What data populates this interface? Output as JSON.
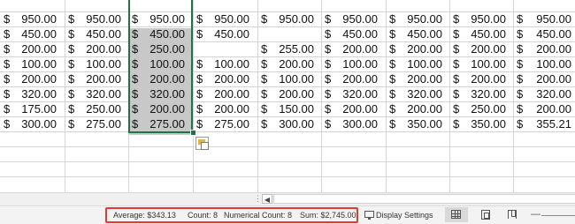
{
  "sheet": {
    "currency_symbol": "$",
    "columns": [
      [
        "950.00",
        "450.00",
        "200.00",
        "100.00",
        "200.00",
        "320.00",
        "175.00",
        "300.00"
      ],
      [
        "950.00",
        "450.00",
        "200.00",
        "100.00",
        "200.00",
        "320.00",
        "250.00",
        "275.00"
      ],
      [
        "950.00",
        "450.00",
        "250.00",
        "100.00",
        "200.00",
        "320.00",
        "200.00",
        "275.00"
      ],
      [
        "950.00",
        "450.00",
        "",
        "100.00",
        "200.00",
        "200.00",
        "200.00",
        "275.00"
      ],
      [
        "950.00",
        "",
        "255.00",
        "200.00",
        "100.00",
        "200.00",
        "150.00",
        "300.00"
      ],
      [
        "950.00",
        "450.00",
        "200.00",
        "100.00",
        "200.00",
        "320.00",
        "200.00",
        "300.00"
      ],
      [
        "950.00",
        "450.00",
        "200.00",
        "100.00",
        "200.00",
        "320.00",
        "200.00",
        "350.00"
      ],
      [
        "950.00",
        "450.00",
        "200.00",
        "100.00",
        "200.00",
        "320.00",
        "250.00",
        "350.00"
      ],
      [
        "950.00",
        "450.00",
        "200.00",
        "100.00",
        "200.00",
        "320.00",
        "200.00",
        "355.21"
      ]
    ],
    "selected_column": 2
  },
  "status_bar": {
    "average": "Average:  $343.13",
    "count": "Count: 8",
    "numerical_count": "Numerical Count: 8",
    "sum": "Sum:  $2,745.00",
    "display_settings": "Display Settings",
    "zoom_minus": "—"
  },
  "colors": {
    "selection_border": "#217346",
    "selection_fill": "#c8c8c8",
    "highlight_box": "#e4392f",
    "gridline": "#d4d4d4"
  },
  "icons": [
    "quick-analysis-icon",
    "display-settings-icon",
    "normal-view-icon",
    "page-layout-view-icon",
    "page-break-preview-icon",
    "scroll-left-icon"
  ]
}
